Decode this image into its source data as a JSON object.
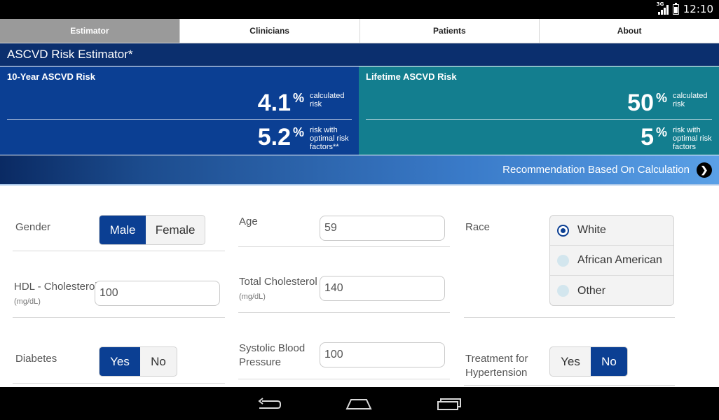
{
  "status_bar": {
    "network": "3G",
    "time": "12:10"
  },
  "tabs": [
    {
      "label": "Estimator",
      "active": true
    },
    {
      "label": "Clinicians",
      "active": false
    },
    {
      "label": "Patients",
      "active": false
    },
    {
      "label": "About",
      "active": false
    }
  ],
  "title": "ASCVD Risk Estimator*",
  "ten_year": {
    "title": "10-Year ASCVD Risk",
    "calculated_value": "4.1",
    "calculated_unit": "%",
    "calculated_desc": "calculated risk",
    "optimal_value": "5.2",
    "optimal_unit": "%",
    "optimal_desc": "risk with optimal risk factors**"
  },
  "lifetime": {
    "title": "Lifetime ASCVD Risk",
    "calculated_value": "50",
    "calculated_unit": "%",
    "calculated_desc": "calculated risk",
    "optimal_value": "5",
    "optimal_unit": "%",
    "optimal_desc": "risk with optimal risk factors"
  },
  "recommendation": {
    "label": "Recommendation Based On Calculation"
  },
  "form": {
    "gender": {
      "label": "Gender",
      "options": [
        "Male",
        "Female"
      ],
      "selected": "Male"
    },
    "age": {
      "label": "Age",
      "value": "59"
    },
    "race": {
      "label": "Race",
      "options": [
        "White",
        "African American",
        "Other"
      ],
      "selected": "White"
    },
    "hdl": {
      "label": "HDL - Cholesterol",
      "unit": "(mg/dL)",
      "value": "100"
    },
    "total_cholesterol": {
      "label": "Total Cholesterol",
      "unit": "(mg/dL)",
      "value": "140"
    },
    "diabetes": {
      "label": "Diabetes",
      "options": [
        "Yes",
        "No"
      ],
      "selected": "Yes"
    },
    "systolic": {
      "label_line1": "Systolic Blood",
      "label_line2": "Pressure",
      "value": "100"
    },
    "hypertension": {
      "label_line1": "Treatment for",
      "label_line2": "Hypertension",
      "options": [
        "Yes",
        "No"
      ],
      "selected": "No"
    }
  },
  "colors": {
    "primary_blue": "#0b3f93",
    "title_blue": "#0b2f6e",
    "teal": "#137e8f",
    "active_tab": "#9a9a9a"
  }
}
